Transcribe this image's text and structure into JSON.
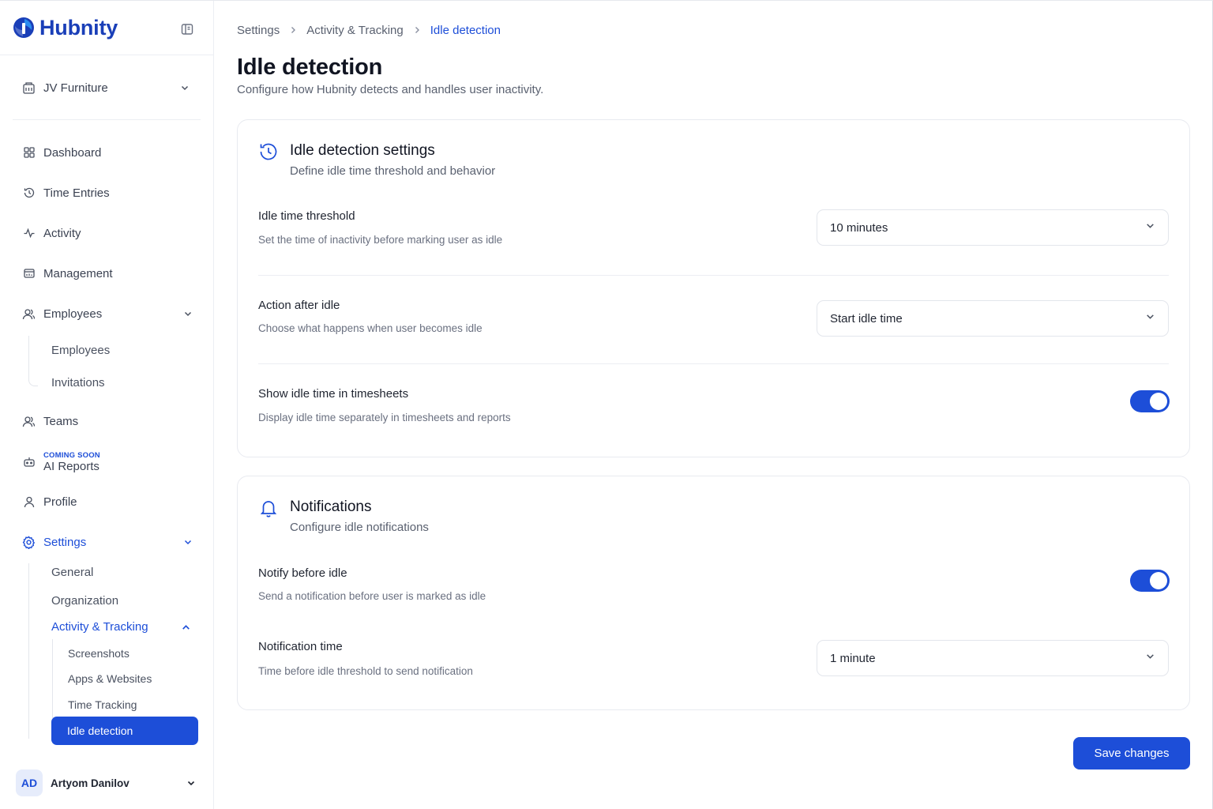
{
  "brand": {
    "name": "Hubnity"
  },
  "org": {
    "name": "JV Furniture"
  },
  "sidebar": {
    "items": [
      {
        "label": "Dashboard"
      },
      {
        "label": "Time Entries"
      },
      {
        "label": "Activity"
      },
      {
        "label": "Management"
      },
      {
        "label": "Employees"
      },
      {
        "label": "Teams"
      },
      {
        "label": "AI Reports",
        "badge": "COMING SOON"
      },
      {
        "label": "Profile"
      },
      {
        "label": "Settings"
      }
    ],
    "employees_sub": [
      "Employees",
      "Invitations"
    ],
    "settings_sub": [
      "General",
      "Organization",
      "Activity & Tracking"
    ],
    "tracking_sub": [
      "Screenshots",
      "Apps & Websites",
      "Time Tracking",
      "Idle detection"
    ]
  },
  "user": {
    "initials": "AD",
    "name": "Artyom Danilov"
  },
  "breadcrumb": [
    "Settings",
    "Activity & Tracking",
    "Idle detection"
  ],
  "page": {
    "title": "Idle detection",
    "subtitle": "Configure how Hubnity detects and handles user inactivity."
  },
  "idle_card": {
    "title": "Idle detection settings",
    "subtitle": "Define idle time threshold and behavior",
    "threshold": {
      "label": "Idle time threshold",
      "help": "Set the time of inactivity before marking user as idle",
      "value": "10 minutes"
    },
    "action": {
      "label": "Action after idle",
      "help": "Choose what happens when user becomes idle",
      "value": "Start idle time"
    },
    "show_idle": {
      "label": "Show idle time in timesheets",
      "help": "Display idle time separately in timesheets and reports",
      "enabled": true
    }
  },
  "notif_card": {
    "title": "Notifications",
    "subtitle": "Configure idle notifications",
    "notify_before": {
      "label": "Notify before idle",
      "help": "Send a notification before user is marked as idle",
      "enabled": true
    },
    "notif_time": {
      "label": "Notification time",
      "help": "Time before idle threshold to send notification",
      "value": "1 minute"
    }
  },
  "actions": {
    "save_label": "Save changes"
  },
  "colors": {
    "accent": "#1d4ed8",
    "brand": "#1a3fb8"
  }
}
